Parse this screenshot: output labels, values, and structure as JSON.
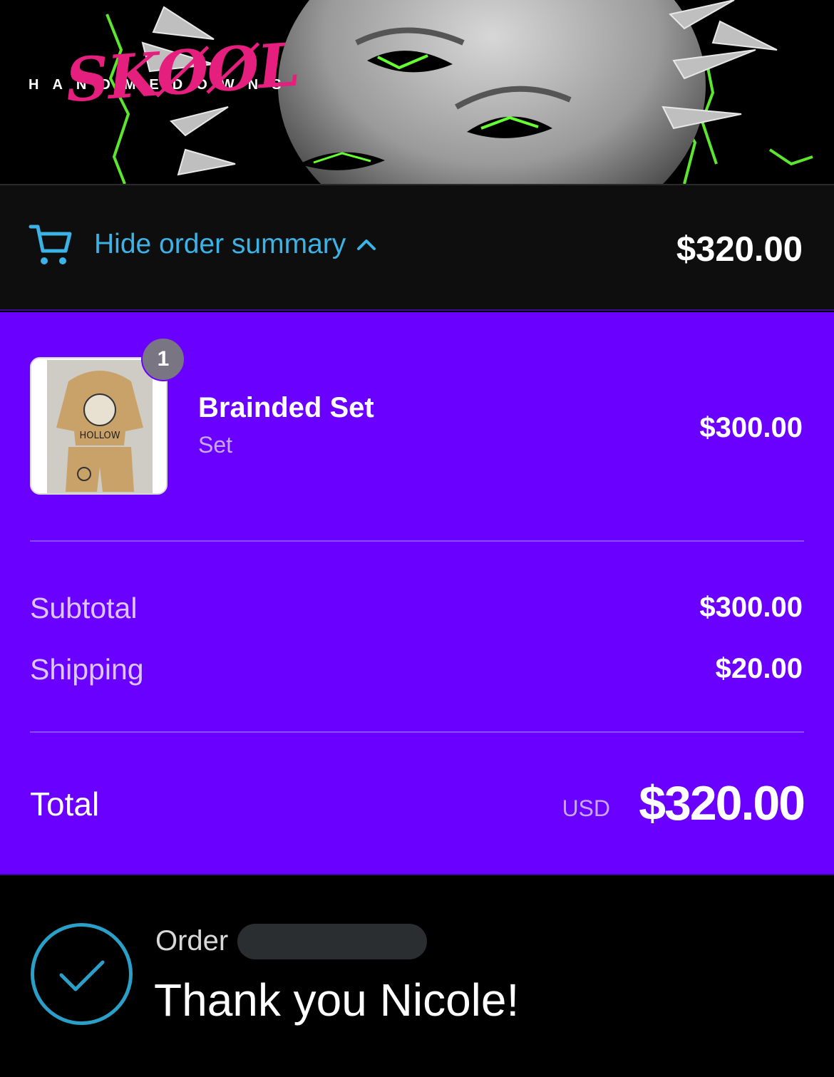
{
  "banner": {
    "brand_letters": "HANDMEDOWNS",
    "brand_script": "SKØØL"
  },
  "summary_bar": {
    "toggle_label": "Hide order summary",
    "total": "$320.00",
    "accent_color": "#3bb3e6"
  },
  "line_items": [
    {
      "quantity": "1",
      "name": "Brainded Set",
      "variant": "Set",
      "price": "$300.00"
    }
  ],
  "totals": {
    "subtotal_label": "Subtotal",
    "subtotal_value": "$300.00",
    "shipping_label": "Shipping",
    "shipping_value": "$20.00",
    "total_label": "Total",
    "currency": "USD",
    "total_value": "$320.00"
  },
  "confirmation": {
    "order_label": "Order",
    "thanks": "Thank you Nicole!"
  },
  "colors": {
    "summary_bg": "#6a00ff",
    "brand_pink": "#e51f7e",
    "check_color": "#2aa0c8"
  }
}
